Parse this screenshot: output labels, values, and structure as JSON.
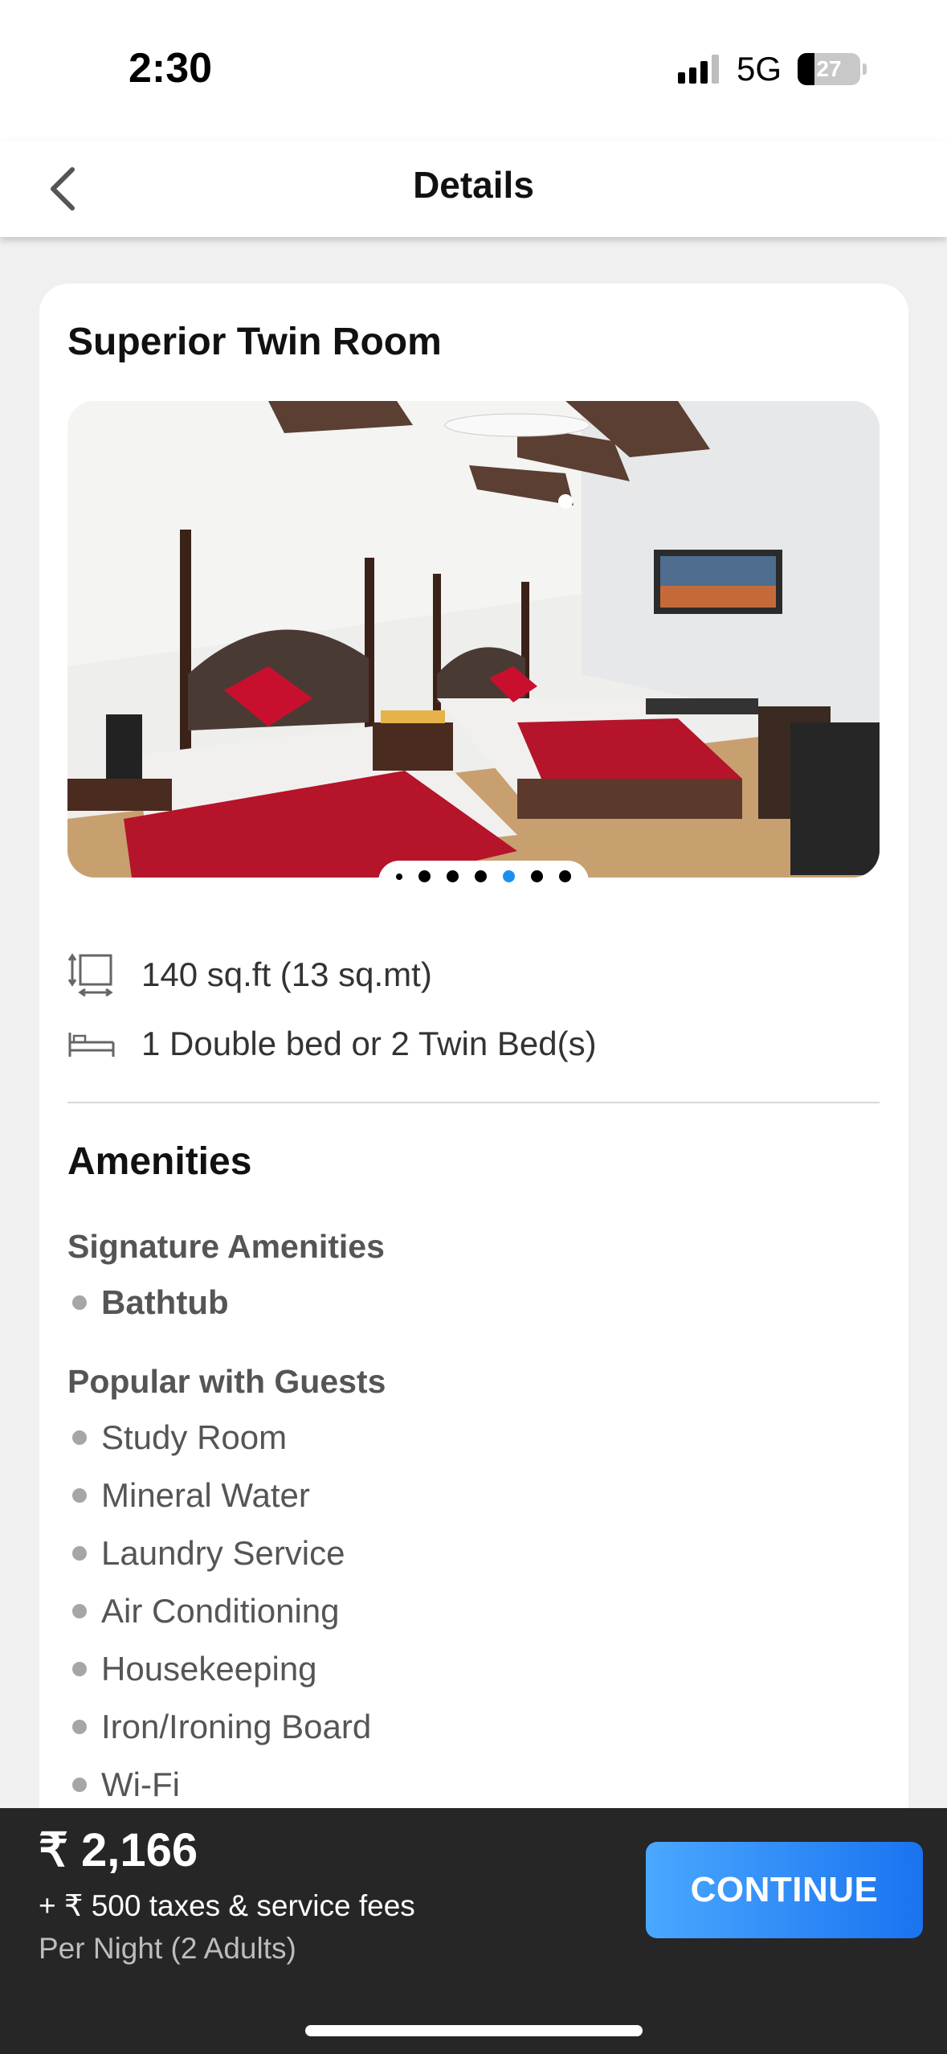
{
  "status_bar": {
    "time": "2:30",
    "network": "5G",
    "battery": "27"
  },
  "header": {
    "title": "Details"
  },
  "room": {
    "title": "Superior Twin Room",
    "gallery_dot_count": 7,
    "gallery_active_index": 4,
    "size": "140 sq.ft (13 sq.mt)",
    "beds": "1 Double bed or 2 Twin Bed(s)"
  },
  "amenities": {
    "title": "Amenities",
    "signature": {
      "title": "Signature Amenities",
      "items": [
        "Bathtub"
      ]
    },
    "popular": {
      "title": "Popular with Guests",
      "items": [
        "Study Room",
        "Mineral Water",
        "Laundry Service",
        "Air Conditioning",
        "Housekeeping",
        "Iron/Ironing Board",
        "Wi-Fi"
      ]
    }
  },
  "footer": {
    "price": "₹ 2,166",
    "taxes": "+ ₹ 500 taxes & service fees",
    "per_night": "Per Night (2 Adults)",
    "continue_label": "CONTINUE"
  },
  "colors": {
    "accent": "#1c8ef0",
    "button_start": "#4aa8ff",
    "button_end": "#1a73f0",
    "footer_bg": "#262626"
  }
}
